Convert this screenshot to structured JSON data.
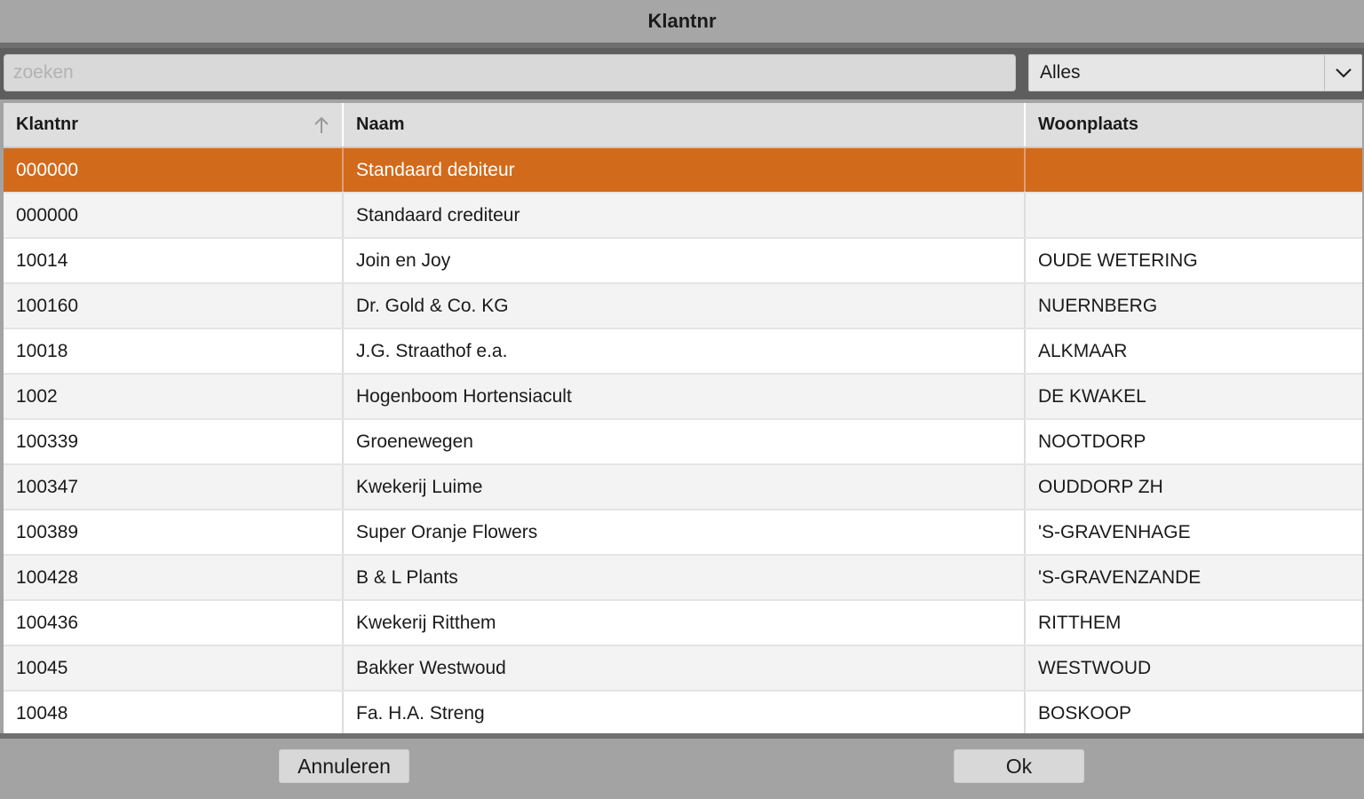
{
  "window": {
    "title": "Klantnr"
  },
  "search": {
    "placeholder": "zoeken",
    "value": ""
  },
  "filter": {
    "selected": "Alles"
  },
  "table": {
    "columns": [
      "Klantnr",
      "Naam",
      "Woonplaats"
    ],
    "sort": {
      "column": "Klantnr",
      "direction": "ascending"
    },
    "rows": [
      {
        "klantnr": "000000",
        "naam": "Standaard debiteur",
        "woonplaats": ""
      },
      {
        "klantnr": "000000",
        "naam": "Standaard crediteur",
        "woonplaats": ""
      },
      {
        "klantnr": "10014",
        "naam": "Join en Joy",
        "woonplaats": "OUDE WETERING"
      },
      {
        "klantnr": "100160",
        "naam": "Dr. Gold & Co. KG",
        "woonplaats": "NUERNBERG"
      },
      {
        "klantnr": "10018",
        "naam": "J.G. Straathof e.a.",
        "woonplaats": "ALKMAAR"
      },
      {
        "klantnr": "1002",
        "naam": "Hogenboom Hortensiacult",
        "woonplaats": "DE KWAKEL"
      },
      {
        "klantnr": "100339",
        "naam": "Groenewegen",
        "woonplaats": "NOOTDORP"
      },
      {
        "klantnr": "100347",
        "naam": "Kwekerij Luime",
        "woonplaats": "OUDDORP ZH"
      },
      {
        "klantnr": "100389",
        "naam": "Super Oranje Flowers",
        "woonplaats": "'S-GRAVENHAGE"
      },
      {
        "klantnr": "100428",
        "naam": "B & L Plants",
        "woonplaats": "'S-GRAVENZANDE"
      },
      {
        "klantnr": "100436",
        "naam": "Kwekerij Ritthem",
        "woonplaats": "RITTHEM"
      },
      {
        "klantnr": "10045",
        "naam": "Bakker Westwoud",
        "woonplaats": "WESTWOUD"
      },
      {
        "klantnr": "10048",
        "naam": "Fa. H.A. Streng",
        "woonplaats": "BOSKOOP"
      }
    ]
  },
  "footer": {
    "cancel_label": "Annuleren",
    "ok_label": "Ok"
  },
  "colors": {
    "selected_row": "#d26a1c",
    "header_bg": "#dedede",
    "window_bg": "#a3a3a3"
  }
}
